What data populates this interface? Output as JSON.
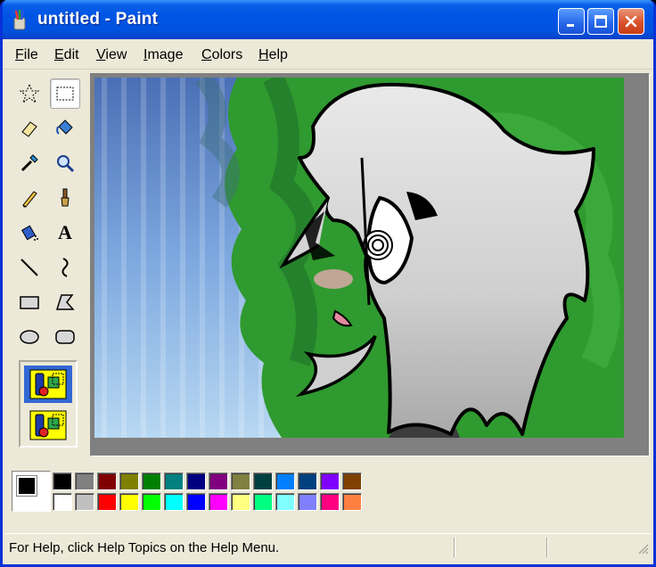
{
  "window": {
    "title": "untitled - Paint"
  },
  "menu": [
    {
      "label": "File",
      "hotkey": "F",
      "rest": "ile"
    },
    {
      "label": "Edit",
      "hotkey": "E",
      "rest": "dit"
    },
    {
      "label": "View",
      "hotkey": "V",
      "rest": "iew"
    },
    {
      "label": "Image",
      "hotkey": "I",
      "rest": "mage"
    },
    {
      "label": "Colors",
      "hotkey": "C",
      "rest": "olors"
    },
    {
      "label": "Help",
      "hotkey": "H",
      "rest": "elp"
    }
  ],
  "tools": [
    "free-form-select",
    "rectangle-select",
    "eraser",
    "fill-with-color",
    "pick-color",
    "magnifier",
    "pencil",
    "brush",
    "airbrush",
    "text",
    "line",
    "curve",
    "rectangle",
    "polygon",
    "ellipse",
    "rounded-rectangle"
  ],
  "selected_tool": "rectangle-select",
  "text_tool_glyph": "A",
  "current_colors": {
    "foreground": "#000000",
    "background": "#ffffff"
  },
  "palette": {
    "top_row": [
      "#000000",
      "#808080",
      "#800000",
      "#808000",
      "#008000",
      "#008080",
      "#000080",
      "#800080",
      "#808040",
      "#004040",
      "#0080ff",
      "#004080",
      "#8000ff",
      "#804000"
    ],
    "bottom_row": [
      "#ffffff",
      "#c0c0c0",
      "#ff0000",
      "#ffff00",
      "#00ff00",
      "#00ffff",
      "#0000ff",
      "#ff00ff",
      "#ffff80",
      "#00ff80",
      "#80ffff",
      "#8080ff",
      "#ff0080",
      "#ff8040"
    ]
  },
  "status": {
    "help_text": "For Help, click Help Topics on the Help Menu."
  }
}
